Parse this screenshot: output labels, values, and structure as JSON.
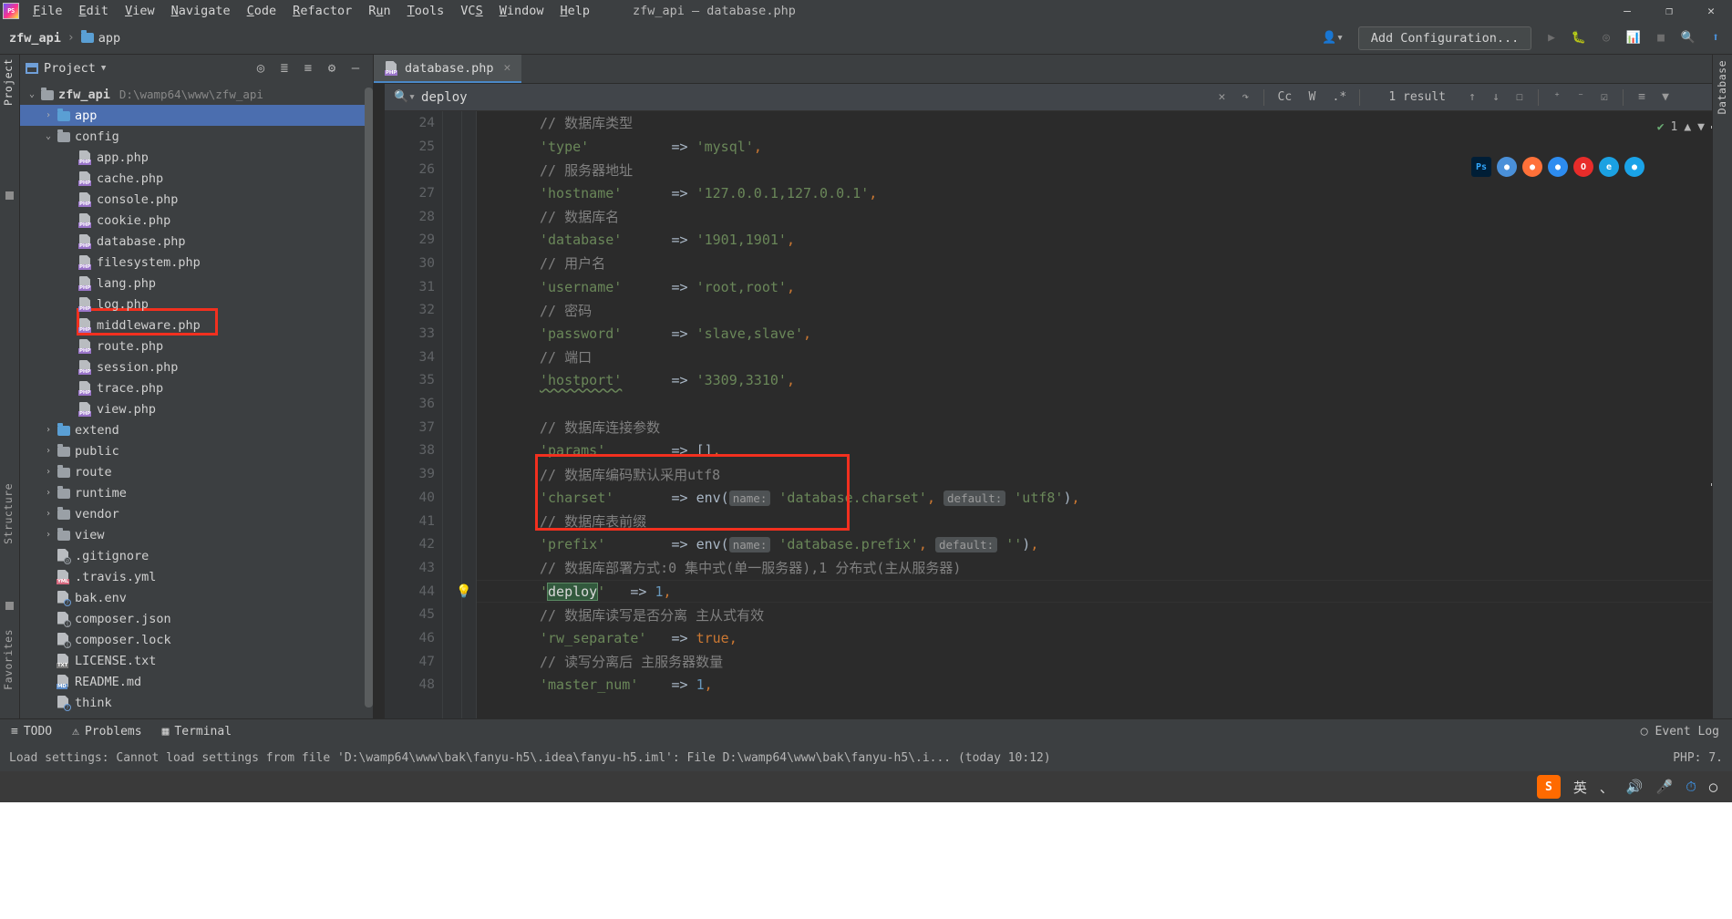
{
  "window": {
    "app_icon": "phpstorm-logo",
    "title": "zfw_api – database.php",
    "menu": [
      "File",
      "Edit",
      "View",
      "Navigate",
      "Code",
      "Refactor",
      "Run",
      "Tools",
      "VCS",
      "Window",
      "Help"
    ],
    "controls": {
      "minimize": "—",
      "maximize": "❐",
      "close": "✕"
    }
  },
  "navbar": {
    "breadcrumb": [
      "zfw_api",
      "app"
    ],
    "add_configuration": "Add Configuration...",
    "icons": [
      "run-icon",
      "debug-icon",
      "coverage-icon",
      "profile-icon",
      "stop-icon",
      "search-everywhere-icon",
      "updates-icon",
      "user-icon"
    ]
  },
  "left_strip": {
    "tabs": [
      "Project",
      "Structure",
      "Favorites"
    ]
  },
  "right_strip": {
    "tabs": [
      "Database"
    ]
  },
  "project": {
    "panel_title": "Project",
    "header_icons": [
      "locate-icon",
      "expand-all-icon",
      "collapse-all-icon",
      "settings-icon",
      "hide-icon"
    ],
    "root": {
      "label": "zfw_api",
      "path": "D:\\wamp64\\www\\zfw_api"
    },
    "items": [
      {
        "label": "app",
        "type": "folder-blue",
        "indent": 1,
        "arrow": "›",
        "selected": true
      },
      {
        "label": "config",
        "type": "folder-grey",
        "indent": 1,
        "arrow": "⌄",
        "selected": false
      },
      {
        "label": "app.php",
        "type": "php",
        "indent": 2,
        "arrow": "",
        "selected": false
      },
      {
        "label": "cache.php",
        "type": "php",
        "indent": 2,
        "arrow": "",
        "selected": false
      },
      {
        "label": "console.php",
        "type": "php",
        "indent": 2,
        "arrow": "",
        "selected": false
      },
      {
        "label": "cookie.php",
        "type": "php",
        "indent": 2,
        "arrow": "",
        "selected": false
      },
      {
        "label": "database.php",
        "type": "php",
        "indent": 2,
        "arrow": "",
        "selected": false,
        "highlighted": true
      },
      {
        "label": "filesystem.php",
        "type": "php",
        "indent": 2,
        "arrow": "",
        "selected": false
      },
      {
        "label": "lang.php",
        "type": "php",
        "indent": 2,
        "arrow": "",
        "selected": false
      },
      {
        "label": "log.php",
        "type": "php",
        "indent": 2,
        "arrow": "",
        "selected": false
      },
      {
        "label": "middleware.php",
        "type": "php",
        "indent": 2,
        "arrow": "",
        "selected": false
      },
      {
        "label": "route.php",
        "type": "php",
        "indent": 2,
        "arrow": "",
        "selected": false
      },
      {
        "label": "session.php",
        "type": "php",
        "indent": 2,
        "arrow": "",
        "selected": false
      },
      {
        "label": "trace.php",
        "type": "php",
        "indent": 2,
        "arrow": "",
        "selected": false
      },
      {
        "label": "view.php",
        "type": "php",
        "indent": 2,
        "arrow": "",
        "selected": false
      },
      {
        "label": "extend",
        "type": "folder-blue",
        "indent": 1,
        "arrow": "›",
        "selected": false
      },
      {
        "label": "public",
        "type": "folder-grey",
        "indent": 1,
        "arrow": "›",
        "selected": false
      },
      {
        "label": "route",
        "type": "folder-grey",
        "indent": 1,
        "arrow": "›",
        "selected": false
      },
      {
        "label": "runtime",
        "type": "folder-grey",
        "indent": 1,
        "arrow": "›",
        "selected": false
      },
      {
        "label": "vendor",
        "type": "folder-grey",
        "indent": 1,
        "arrow": "›",
        "selected": false
      },
      {
        "label": "view",
        "type": "folder-grey",
        "indent": 1,
        "arrow": "›",
        "selected": false
      },
      {
        "label": ".gitignore",
        "type": "ignore",
        "indent": 1,
        "arrow": "",
        "selected": false
      },
      {
        "label": ".travis.yml",
        "type": "yml",
        "indent": 1,
        "arrow": "",
        "selected": false
      },
      {
        "label": "bak.env",
        "type": "unknown",
        "indent": 1,
        "arrow": "",
        "selected": false
      },
      {
        "label": "composer.json",
        "type": "json",
        "indent": 1,
        "arrow": "",
        "selected": false
      },
      {
        "label": "composer.lock",
        "type": "lock",
        "indent": 1,
        "arrow": "",
        "selected": false
      },
      {
        "label": "LICENSE.txt",
        "type": "txt",
        "indent": 1,
        "arrow": "",
        "selected": false
      },
      {
        "label": "README.md",
        "type": "md",
        "indent": 1,
        "arrow": "",
        "selected": false
      },
      {
        "label": "think",
        "type": "unknown",
        "indent": 1,
        "arrow": "",
        "selected": false
      }
    ]
  },
  "editor": {
    "tab": {
      "label": "database.php",
      "icon": "php-file-icon",
      "close": "✕"
    },
    "search": {
      "query": "deploy",
      "placeholder": "Search",
      "result_text": "1 result",
      "options": [
        "Cc",
        "W",
        ".*"
      ],
      "buttons": [
        "clear-icon",
        "history-icon",
        "prev-match-icon",
        "next-match-icon",
        "select-all-icon",
        "add-line-icon",
        "remove-line-icon",
        "edit-icon",
        "filter-list-icon",
        "filter-icon",
        "close-icon"
      ]
    },
    "inspection": {
      "count": "1",
      "check": "✔"
    },
    "browsers": [
      {
        "name": "photoshop-icon",
        "glyph": "Ps",
        "color": "#31a8ff",
        "bg": "#001e36",
        "square": true
      },
      {
        "name": "chrome-icon",
        "glyph": "●",
        "color": "#ffffff",
        "bg": "#4a90d9",
        "square": false
      },
      {
        "name": "firefox-icon",
        "glyph": "●",
        "color": "#ffffff",
        "bg": "#ff7139",
        "square": false
      },
      {
        "name": "edge-icon",
        "glyph": "●",
        "color": "#ffffff",
        "bg": "#2d8cf0",
        "square": false
      },
      {
        "name": "opera-icon",
        "glyph": "O",
        "color": "#ffffff",
        "bg": "#e82c2a",
        "square": false
      },
      {
        "name": "ie-icon",
        "glyph": "e",
        "color": "#ffffff",
        "bg": "#1ba1e2",
        "square": false
      },
      {
        "name": "safari-icon",
        "glyph": "●",
        "color": "#ffffff",
        "bg": "#1aa3e8",
        "square": false
      }
    ],
    "lines": [
      {
        "n": "24",
        "segments": [
          {
            "t": "// 数据库类型",
            "c": "c-com"
          }
        ]
      },
      {
        "n": "25",
        "segments": [
          {
            "t": "'type'",
            "c": "c-str"
          },
          {
            "t": "          ",
            "c": "c-plain"
          },
          {
            "t": "=> ",
            "c": "c-arrow"
          },
          {
            "t": "'mysql'",
            "c": "c-str"
          },
          {
            "t": ",",
            "c": "c-key"
          }
        ]
      },
      {
        "n": "26",
        "segments": [
          {
            "t": "// 服务器地址",
            "c": "c-com"
          }
        ]
      },
      {
        "n": "27",
        "segments": [
          {
            "t": "'hostname'",
            "c": "c-str"
          },
          {
            "t": "      ",
            "c": "c-plain"
          },
          {
            "t": "=> ",
            "c": "c-arrow"
          },
          {
            "t": "'127.0.0.1,127.0.0.1'",
            "c": "c-str"
          },
          {
            "t": ",",
            "c": "c-key"
          }
        ]
      },
      {
        "n": "28",
        "segments": [
          {
            "t": "// 数据库名",
            "c": "c-com"
          }
        ]
      },
      {
        "n": "29",
        "segments": [
          {
            "t": "'database'",
            "c": "c-str"
          },
          {
            "t": "      ",
            "c": "c-plain"
          },
          {
            "t": "=> ",
            "c": "c-arrow"
          },
          {
            "t": "'1901,1901'",
            "c": "c-str"
          },
          {
            "t": ",",
            "c": "c-key"
          }
        ]
      },
      {
        "n": "30",
        "segments": [
          {
            "t": "// 用户名",
            "c": "c-com"
          }
        ]
      },
      {
        "n": "31",
        "segments": [
          {
            "t": "'username'",
            "c": "c-str"
          },
          {
            "t": "      ",
            "c": "c-plain"
          },
          {
            "t": "=> ",
            "c": "c-arrow"
          },
          {
            "t": "'root,root'",
            "c": "c-str"
          },
          {
            "t": ",",
            "c": "c-key"
          }
        ]
      },
      {
        "n": "32",
        "segments": [
          {
            "t": "// 密码",
            "c": "c-com"
          }
        ]
      },
      {
        "n": "33",
        "segments": [
          {
            "t": "'password'",
            "c": "c-str"
          },
          {
            "t": "      ",
            "c": "c-plain"
          },
          {
            "t": "=> ",
            "c": "c-arrow"
          },
          {
            "t": "'slave,slave'",
            "c": "c-str"
          },
          {
            "t": ",",
            "c": "c-key"
          }
        ]
      },
      {
        "n": "34",
        "segments": [
          {
            "t": "// 端口",
            "c": "c-com"
          }
        ]
      },
      {
        "n": "35",
        "segments": [
          {
            "t": "'hostport'",
            "c": "c-str squiggle"
          },
          {
            "t": "      ",
            "c": "c-plain"
          },
          {
            "t": "=> ",
            "c": "c-arrow"
          },
          {
            "t": "'3309,3310'",
            "c": "c-str"
          },
          {
            "t": ",",
            "c": "c-key"
          }
        ]
      },
      {
        "n": "36",
        "segments": []
      },
      {
        "n": "37",
        "segments": [
          {
            "t": "// 数据库连接参数",
            "c": "c-com"
          }
        ]
      },
      {
        "n": "38",
        "segments": [
          {
            "t": "'params'",
            "c": "c-str"
          },
          {
            "t": "        ",
            "c": "c-plain"
          },
          {
            "t": "=> ",
            "c": "c-arrow"
          },
          {
            "t": "[]",
            "c": "c-plain"
          },
          {
            "t": ",",
            "c": "c-key"
          }
        ]
      },
      {
        "n": "39",
        "segments": [
          {
            "t": "// 数据库编码默认采用utf8",
            "c": "c-com"
          }
        ]
      },
      {
        "n": "40",
        "segments": [
          {
            "t": "'charset'",
            "c": "c-str"
          },
          {
            "t": "       ",
            "c": "c-plain"
          },
          {
            "t": "=> ",
            "c": "c-arrow"
          },
          {
            "t": "env(",
            "c": "c-plain"
          },
          {
            "t": "name:",
            "c": "hint"
          },
          {
            "t": " ",
            "c": "c-plain"
          },
          {
            "t": "'database.charset'",
            "c": "c-str"
          },
          {
            "t": ", ",
            "c": "c-key"
          },
          {
            "t": "default:",
            "c": "hint"
          },
          {
            "t": " ",
            "c": "c-plain"
          },
          {
            "t": "'utf8'",
            "c": "c-str"
          },
          {
            "t": ")",
            "c": "c-plain"
          },
          {
            "t": ",",
            "c": "c-key"
          }
        ]
      },
      {
        "n": "41",
        "segments": [
          {
            "t": "// 数据库表前缀",
            "c": "c-com"
          }
        ]
      },
      {
        "n": "42",
        "segments": [
          {
            "t": "'prefix'",
            "c": "c-str"
          },
          {
            "t": "        ",
            "c": "c-plain"
          },
          {
            "t": "=> ",
            "c": "c-arrow"
          },
          {
            "t": "env(",
            "c": "c-plain"
          },
          {
            "t": "name:",
            "c": "hint"
          },
          {
            "t": " ",
            "c": "c-plain"
          },
          {
            "t": "'database.prefix'",
            "c": "c-str"
          },
          {
            "t": ", ",
            "c": "c-key"
          },
          {
            "t": "default:",
            "c": "hint"
          },
          {
            "t": " ",
            "c": "c-plain"
          },
          {
            "t": "''",
            "c": "c-str"
          },
          {
            "t": ")",
            "c": "c-plain"
          },
          {
            "t": ",",
            "c": "c-key"
          }
        ]
      },
      {
        "n": "43",
        "segments": [
          {
            "t": "// 数据库部署方式:0 集中式(单一服务器),1 分布式(主从服务器)",
            "c": "c-com"
          }
        ]
      },
      {
        "n": "44",
        "bulb": true,
        "caret": true,
        "segments": [
          {
            "t": "'",
            "c": "c-str"
          },
          {
            "t": "deploy",
            "c": "match"
          },
          {
            "t": "'",
            "c": "c-str"
          },
          {
            "t": "   ",
            "c": "c-plain"
          },
          {
            "t": "=> ",
            "c": "c-arrow"
          },
          {
            "t": "1",
            "c": "c-num"
          },
          {
            "t": ",",
            "c": "c-key"
          }
        ]
      },
      {
        "n": "45",
        "segments": [
          {
            "t": "// 数据库读写是否分离 主从式有效",
            "c": "c-com"
          }
        ]
      },
      {
        "n": "46",
        "segments": [
          {
            "t": "'rw_separate'",
            "c": "c-str"
          },
          {
            "t": "   ",
            "c": "c-plain"
          },
          {
            "t": "=> ",
            "c": "c-arrow"
          },
          {
            "t": "true",
            "c": "c-bool"
          },
          {
            "t": ",",
            "c": "c-key"
          }
        ]
      },
      {
        "n": "47",
        "segments": [
          {
            "t": "// 读写分离后 主服务器数量",
            "c": "c-com"
          }
        ]
      },
      {
        "n": "48",
        "segments": [
          {
            "t": "'master_num'",
            "c": "c-str"
          },
          {
            "t": "    ",
            "c": "c-plain"
          },
          {
            "t": "=> ",
            "c": "c-arrow"
          },
          {
            "t": "1",
            "c": "c-num"
          },
          {
            "t": ",",
            "c": "c-key"
          }
        ]
      }
    ]
  },
  "bottom_bar": {
    "items": [
      {
        "label": "TODO",
        "icon": "todo-icon"
      },
      {
        "label": "Problems",
        "icon": "problems-icon"
      },
      {
        "label": "Terminal",
        "icon": "terminal-icon"
      }
    ],
    "event_log": "Event Log",
    "event_log_icon": "event-log-icon"
  },
  "status_bar": {
    "message": "Load settings: Cannot load settings from file 'D:\\wamp64\\www\\bak\\fanyu-h5\\.idea\\fanyu-h5.iml': File D:\\wamp64\\www\\bak\\fanyu-h5\\.i... (today 10:12)",
    "right": "PHP: 7."
  },
  "taskbar": {
    "ime_lang": "英",
    "icons": [
      "sogou-icon",
      "ime-icon",
      "mic-icon",
      "volume-icon",
      "keyboard-icon",
      "network-icon",
      "battery-icon"
    ]
  }
}
